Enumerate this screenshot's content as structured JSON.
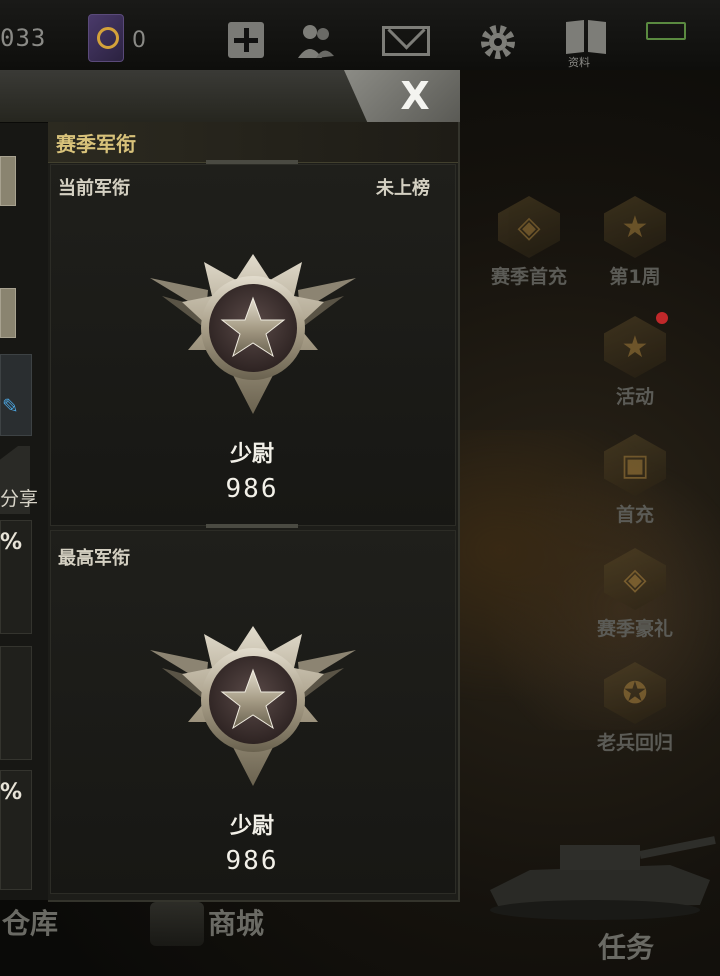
{
  "topbar": {
    "currency_value": "033",
    "tickets_value": "0",
    "doc_label": "资料",
    "icons": [
      "book-icon",
      "plus-icon",
      "friends-icon",
      "mail-icon",
      "gear-icon",
      "document-icon",
      "battery-icon"
    ]
  },
  "side_events": [
    {
      "label": "赛季首充",
      "icon": "season-badge-icon"
    },
    {
      "label": "第1周",
      "icon": "gold-star-icon"
    },
    {
      "label": "活动",
      "icon": "star-medal-icon"
    },
    {
      "label": "首充",
      "icon": "chest-icon"
    },
    {
      "label": "赛季豪礼",
      "icon": "season-gift-icon"
    },
    {
      "label": "老兵回归",
      "icon": "veteran-icon"
    }
  ],
  "bottom_bar": {
    "warehouse_label": "仓库",
    "shop_label": "商城",
    "mission_label": "任务"
  },
  "left_panel": {
    "share_label": "分享",
    "percent_1": "%",
    "percent_2": "%"
  },
  "panel": {
    "close_label": "X",
    "section_title": "赛季军衔",
    "current_rank": {
      "label": "当前军衔",
      "status": "未上榜",
      "rank_name": "少尉",
      "score": "986"
    },
    "highest_rank": {
      "label": "最高军衔",
      "rank_name": "少尉",
      "score": "986"
    }
  },
  "colors": {
    "title_gold": "#d8c27a",
    "badge_silver": "#c8c0ae",
    "panel_bg": "#1d1d19"
  }
}
